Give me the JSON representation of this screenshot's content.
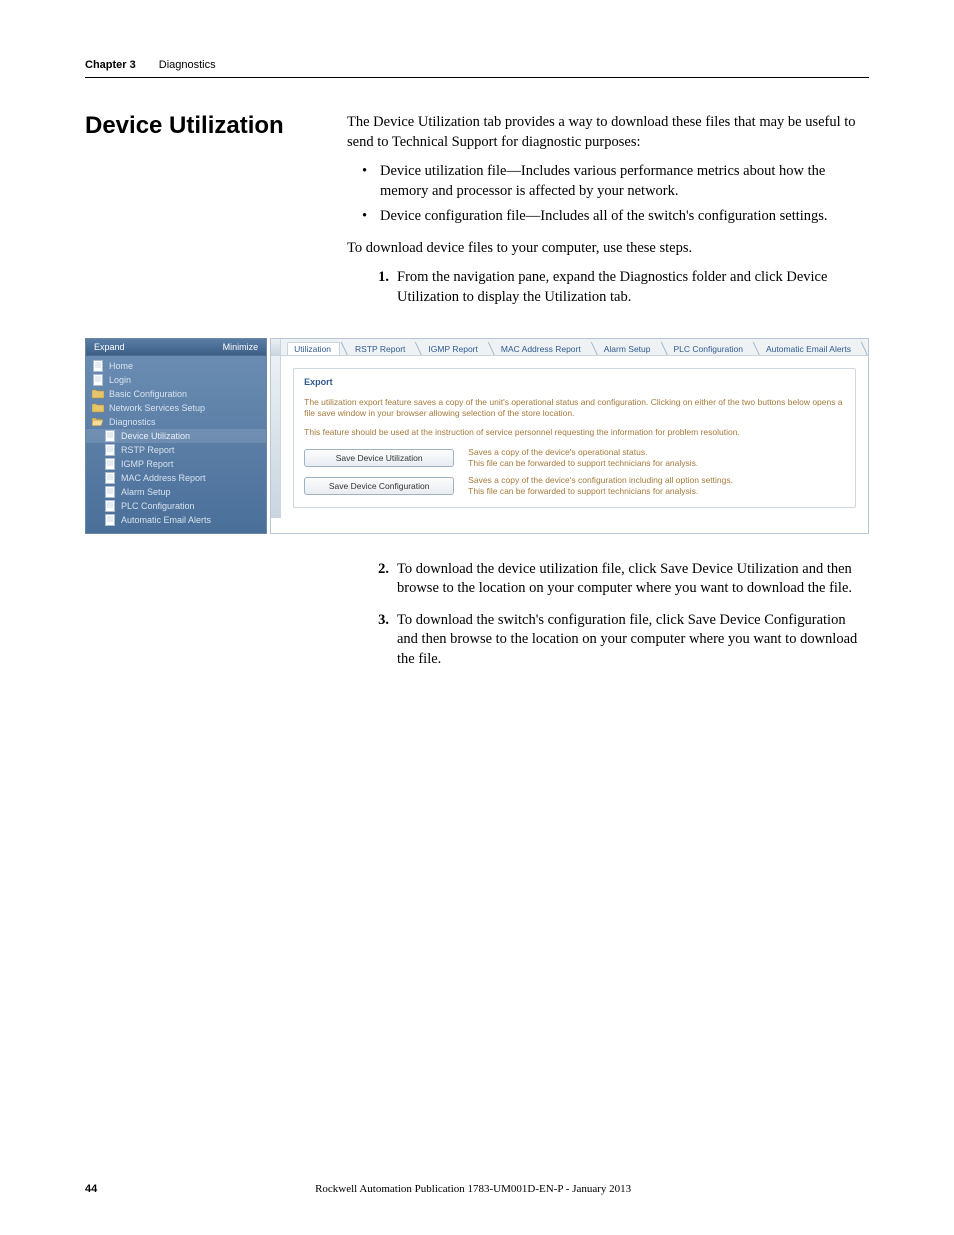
{
  "header": {
    "chapter": "Chapter 3",
    "section": "Diagnostics"
  },
  "heading": "Device Utilization",
  "intro": {
    "p1": "The Device Utilization tab provides a way to download these files that may be useful to send to Technical Support for diagnostic purposes:",
    "bullets": [
      "Device utilization file—Includes various performance metrics about how the memory and processor is affected by your network.",
      "Device configuration file—Includes all of the switch's configuration settings."
    ],
    "p2": "To download device files to your computer, use these steps."
  },
  "steps": {
    "s1": "From the navigation pane, expand the Diagnostics folder and click Device Utilization to display the Utilization tab.",
    "s2": "To download the device utilization file, click Save Device Utilization and then browse to the location on your computer where you want to download the file.",
    "s3": "To download the switch's configuration file, click Save Device Configuration and then browse to the location on your computer where you want to download the file."
  },
  "screenshot": {
    "nav": {
      "expand": "Expand",
      "minimize": "Minimize",
      "items": [
        {
          "label": "Home",
          "icon": "page"
        },
        {
          "label": "Login",
          "icon": "page"
        },
        {
          "label": "Basic Configuration",
          "icon": "folder-closed"
        },
        {
          "label": "Network Services Setup",
          "icon": "folder-closed"
        },
        {
          "label": "Diagnostics",
          "icon": "folder-open"
        }
      ],
      "sub": [
        {
          "label": "Device Utilization",
          "selected": true
        },
        {
          "label": "RSTP Report"
        },
        {
          "label": "IGMP Report"
        },
        {
          "label": "MAC Address Report"
        },
        {
          "label": "Alarm Setup"
        },
        {
          "label": "PLC Configuration"
        },
        {
          "label": "Automatic Email Alerts"
        }
      ]
    },
    "tabs": [
      "Utilization",
      "RSTP Report",
      "IGMP Report",
      "MAC Address Report",
      "Alarm Setup",
      "PLC Configuration",
      "Automatic Email Alerts"
    ],
    "export": {
      "title": "Export",
      "desc1": "The utilization export feature saves a copy of the unit's operational status and configuration. Clicking on either of the two buttons below opens a file save window in your browser allowing selection of the store location.",
      "desc2": "This feature should be used at the instruction of service personnel requesting the information for problem resolution.",
      "rows": [
        {
          "button": "Save Device Utilization",
          "text": "Saves a copy of the device's operational status.\nThis file can be forwarded to support technicians for analysis."
        },
        {
          "button": "Save Device Configuration",
          "text": "Saves a copy of the device's configuration including all option settings.\nThis file can be forwarded to support technicians for analysis."
        }
      ]
    }
  },
  "footer": {
    "page": "44",
    "pub": "Rockwell Automation Publication 1783-UM001D-EN-P - January 2013"
  }
}
